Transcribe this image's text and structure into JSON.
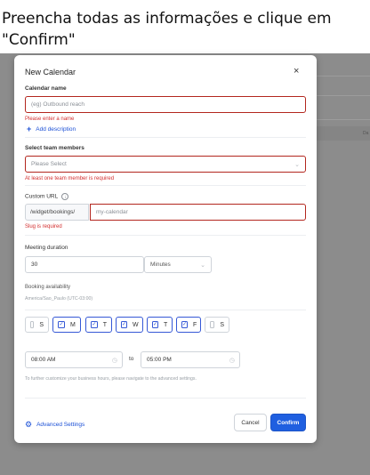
{
  "instruction": {
    "line1": "Preencha todas as informações e clique em",
    "line2": "\"Confirm\""
  },
  "background": {
    "tag": "Da"
  },
  "modal": {
    "title": "New Calendar",
    "close_glyph": "×",
    "calendar_name": {
      "label": "Calendar name",
      "placeholder": "(eg) Outbound reach",
      "value": "",
      "error": "Please enter a name",
      "add_description": "Add description",
      "add_icon": "plus-icon"
    },
    "team_members": {
      "label": "Select team members",
      "placeholder": "Please Select",
      "error": "At least one team member is required"
    },
    "custom_url": {
      "label": "Custom URL",
      "info_icon": "info-icon",
      "prefix": "/widget/bookings/",
      "placeholder": "my-calendar",
      "error": "Slug is required"
    },
    "meeting_duration": {
      "label": "Meeting duration",
      "value": "30",
      "unit": "Minutes"
    },
    "booking_availability": {
      "label": "Booking availability",
      "timezone": "America/Sao_Paulo (UTC-03:00)",
      "days": [
        {
          "label": "S",
          "checked": false
        },
        {
          "label": "M",
          "checked": true
        },
        {
          "label": "T",
          "checked": true
        },
        {
          "label": "W",
          "checked": true
        },
        {
          "label": "T",
          "checked": true
        },
        {
          "label": "F",
          "checked": true
        },
        {
          "label": "S",
          "checked": false
        }
      ],
      "start_time": "08:00 AM",
      "to": "to",
      "end_time": "05:00 PM",
      "hint": "To further customize your business hours, please navigate to the advanced settings."
    },
    "footer": {
      "advanced_settings": "Advanced Settings",
      "cancel": "Cancel",
      "confirm": "Confirm"
    },
    "colors": {
      "accent": "#1f5fe0",
      "error": "#d32f2f"
    }
  }
}
